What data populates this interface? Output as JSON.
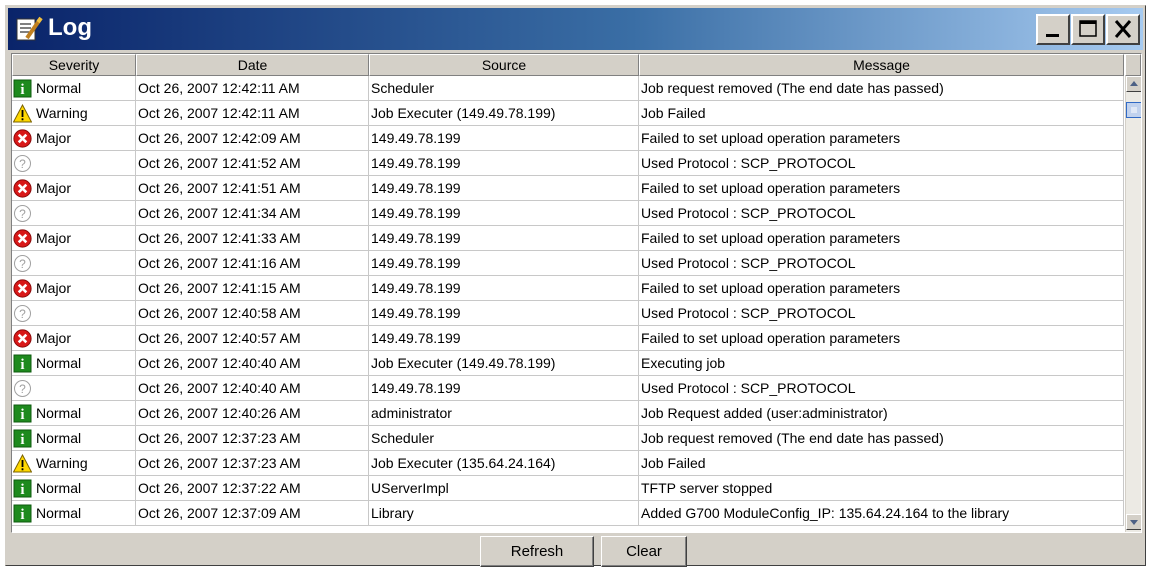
{
  "window": {
    "title": "Log",
    "controls": [
      "minimize-icon",
      "maximize-icon",
      "close-icon"
    ]
  },
  "table": {
    "columns": [
      "Severity",
      "Date",
      "Source",
      "Message"
    ],
    "rows": [
      {
        "severity_icon": "info-icon",
        "severity": "Normal",
        "date": "Oct 26, 2007 12:42:11 AM",
        "source": "Scheduler",
        "message": "Job request removed (The end date has passed)"
      },
      {
        "severity_icon": "warning-icon",
        "severity": "Warning",
        "date": "Oct 26, 2007 12:42:11 AM",
        "source": "Job Executer (149.49.78.199)",
        "message": "Job Failed"
      },
      {
        "severity_icon": "error-icon",
        "severity": "Major",
        "date": "Oct 26, 2007 12:42:09 AM",
        "source": "149.49.78.199",
        "message": "Failed to set upload operation parameters"
      },
      {
        "severity_icon": "unknown-icon",
        "severity": "",
        "date": "Oct 26, 2007 12:41:52 AM",
        "source": "149.49.78.199",
        "message": "Used Protocol : SCP_PROTOCOL"
      },
      {
        "severity_icon": "error-icon",
        "severity": "Major",
        "date": "Oct 26, 2007 12:41:51 AM",
        "source": "149.49.78.199",
        "message": "Failed to set upload operation parameters"
      },
      {
        "severity_icon": "unknown-icon",
        "severity": "",
        "date": "Oct 26, 2007 12:41:34 AM",
        "source": "149.49.78.199",
        "message": "Used Protocol : SCP_PROTOCOL"
      },
      {
        "severity_icon": "error-icon",
        "severity": "Major",
        "date": "Oct 26, 2007 12:41:33 AM",
        "source": "149.49.78.199",
        "message": "Failed to set upload operation parameters"
      },
      {
        "severity_icon": "unknown-icon",
        "severity": "",
        "date": "Oct 26, 2007 12:41:16 AM",
        "source": "149.49.78.199",
        "message": "Used Protocol : SCP_PROTOCOL"
      },
      {
        "severity_icon": "error-icon",
        "severity": "Major",
        "date": "Oct 26, 2007 12:41:15 AM",
        "source": "149.49.78.199",
        "message": "Failed to set upload operation parameters"
      },
      {
        "severity_icon": "unknown-icon",
        "severity": "",
        "date": "Oct 26, 2007 12:40:58 AM",
        "source": "149.49.78.199",
        "message": "Used Protocol : SCP_PROTOCOL"
      },
      {
        "severity_icon": "error-icon",
        "severity": "Major",
        "date": "Oct 26, 2007 12:40:57 AM",
        "source": "149.49.78.199",
        "message": "Failed to set upload operation parameters"
      },
      {
        "severity_icon": "info-icon",
        "severity": "Normal",
        "date": "Oct 26, 2007 12:40:40 AM",
        "source": "Job Executer (149.49.78.199)",
        "message": "Executing job"
      },
      {
        "severity_icon": "unknown-icon",
        "severity": "",
        "date": "Oct 26, 2007 12:40:40 AM",
        "source": "149.49.78.199",
        "message": "Used Protocol : SCP_PROTOCOL"
      },
      {
        "severity_icon": "info-icon",
        "severity": "Normal",
        "date": "Oct 26, 2007 12:40:26 AM",
        "source": "administrator",
        "message": "Job Request added (user:administrator)"
      },
      {
        "severity_icon": "info-icon",
        "severity": "Normal",
        "date": "Oct 26, 2007 12:37:23 AM",
        "source": "Scheduler",
        "message": "Job request removed (The end date has passed)"
      },
      {
        "severity_icon": "warning-icon",
        "severity": "Warning",
        "date": "Oct 26, 2007 12:37:23 AM",
        "source": "Job Executer (135.64.24.164)",
        "message": "Job Failed"
      },
      {
        "severity_icon": "info-icon",
        "severity": "Normal",
        "date": "Oct 26, 2007 12:37:22 AM",
        "source": "UServerImpl",
        "message": "TFTP server stopped"
      },
      {
        "severity_icon": "info-icon",
        "severity": "Normal",
        "date": "Oct 26, 2007 12:37:09 AM",
        "source": "Library",
        "message": "Added G700 ModuleConfig_IP: 135.64.24.164 to the library"
      }
    ]
  },
  "buttons": {
    "refresh": "Refresh",
    "clear": "Clear"
  },
  "colors": {
    "titlebar_start": "#0a246a",
    "titlebar_end": "#a6caf0",
    "info": "#1e8a1e",
    "warning": "#ffd800",
    "error": "#d81818",
    "unknown": "#a0a0a0"
  }
}
